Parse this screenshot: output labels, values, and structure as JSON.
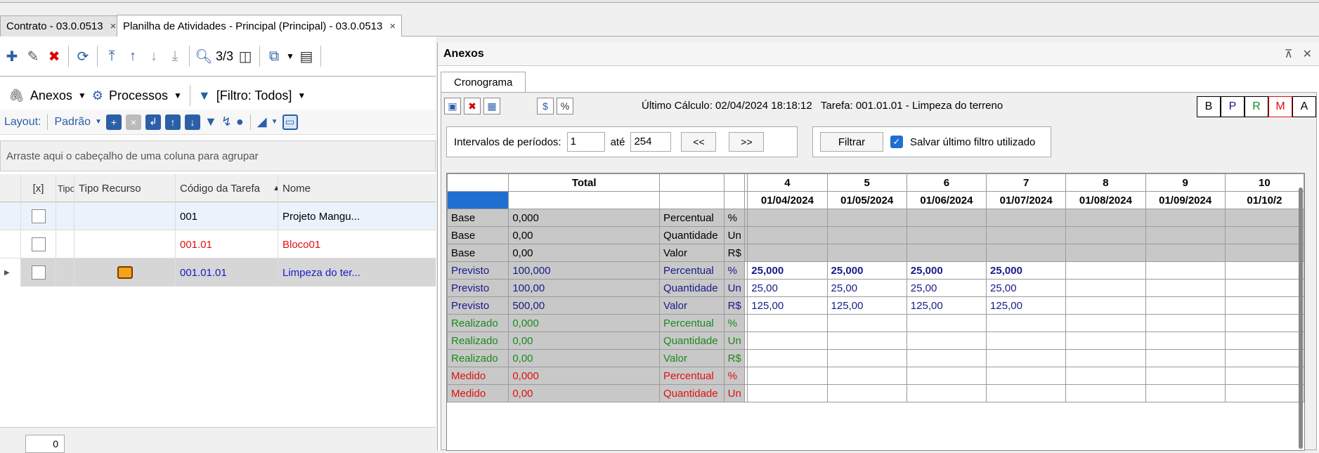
{
  "doc_tabs": [
    {
      "label": "Contrato - 03.0.0513",
      "close": "×"
    },
    {
      "label": "Planilha de Atividades - Principal (Principal) - 03.0.0513",
      "close": "×"
    }
  ],
  "left": {
    "toolbar": {
      "record_counter": "3/3"
    },
    "toolbar2": {
      "anexos": "Anexos",
      "processos": "Processos",
      "filtro": "[Filtro: Todos]"
    },
    "layout": {
      "label": "Layout:",
      "value": "Padrão"
    },
    "group_hint": "Arraste aqui o cabeçalho de uma coluna para agrupar",
    "columns": [
      "[x]",
      "Tipo",
      "Tipo Recurso",
      "Código da Tarefa",
      "Nome"
    ],
    "rows": [
      {
        "codigo": "001",
        "nome": "Projeto Mangu...",
        "color": "#000000"
      },
      {
        "codigo": "001.01",
        "nome": "Bloco01",
        "color": "#e01010"
      },
      {
        "codigo": "001.01.01",
        "nome": "Limpeza do ter...",
        "color": "#1a1aca"
      }
    ],
    "page_value": "0"
  },
  "right": {
    "title": "Anexos",
    "subtab": "Cronograma",
    "ultimo_calculo_label": "Último Cálculo:",
    "ultimo_calculo_value": "02/04/2024 18:18:12",
    "tarefa_label": "Tarefa:",
    "tarefa_value": "001.01.01 - Limpeza do terreno",
    "bprma": [
      "B",
      "P",
      "R",
      "M",
      "A"
    ],
    "intervalos_label": "Intervalos de períodos:",
    "from": "1",
    "ate_label": "até",
    "to": "254",
    "prev": "<<",
    "next": ">>",
    "filtrar": "Filtrar",
    "salvar_label": "Salvar último filtro utilizado",
    "grid": {
      "total_label": "Total",
      "period_numbers": [
        "4",
        "5",
        "6",
        "7",
        "8",
        "9",
        "10"
      ],
      "period_dates": [
        "01/04/2024",
        "01/05/2024",
        "01/06/2024",
        "01/07/2024",
        "01/08/2024",
        "01/09/2024",
        "01/10/2"
      ],
      "rows": [
        {
          "tipo": "Base",
          "total": "0,000",
          "medida": "Percentual",
          "un": "%",
          "vals": [
            "",
            "",
            "",
            "",
            "",
            "",
            ""
          ],
          "cls": "gray",
          "txt": ""
        },
        {
          "tipo": "Base",
          "total": "0,00",
          "medida": "Quantidade",
          "un": "Un",
          "vals": [
            "",
            "",
            "",
            "",
            "",
            "",
            ""
          ],
          "cls": "gray",
          "txt": ""
        },
        {
          "tipo": "Base",
          "total": "0,00",
          "medida": "Valor",
          "un": "R$",
          "vals": [
            "",
            "",
            "",
            "",
            "",
            "",
            ""
          ],
          "cls": "gray",
          "txt": ""
        },
        {
          "tipo": "Previsto",
          "total": "100,000",
          "medida": "Percentual",
          "un": "%",
          "vals": [
            "25,000",
            "25,000",
            "25,000",
            "25,000",
            "",
            "",
            ""
          ],
          "cls": "",
          "txt": "blue",
          "bold": true
        },
        {
          "tipo": "Previsto",
          "total": "100,00",
          "medida": "Quantidade",
          "un": "Un",
          "vals": [
            "25,00",
            "25,00",
            "25,00",
            "25,00",
            "",
            "",
            ""
          ],
          "cls": "",
          "txt": "blue"
        },
        {
          "tipo": "Previsto",
          "total": "500,00",
          "medida": "Valor",
          "un": "R$",
          "vals": [
            "125,00",
            "125,00",
            "125,00",
            "125,00",
            "",
            "",
            ""
          ],
          "cls": "",
          "txt": "blue"
        },
        {
          "tipo": "Realizado",
          "total": "0,000",
          "medida": "Percentual",
          "un": "%",
          "vals": [
            "",
            "",
            "",
            "",
            "",
            "",
            ""
          ],
          "cls": "",
          "txt": "green"
        },
        {
          "tipo": "Realizado",
          "total": "0,00",
          "medida": "Quantidade",
          "un": "Un",
          "vals": [
            "",
            "",
            "",
            "",
            "",
            "",
            ""
          ],
          "cls": "",
          "txt": "green"
        },
        {
          "tipo": "Realizado",
          "total": "0,00",
          "medida": "Valor",
          "un": "R$",
          "vals": [
            "",
            "",
            "",
            "",
            "",
            "",
            ""
          ],
          "cls": "",
          "txt": "green"
        },
        {
          "tipo": "Medido",
          "total": "0,000",
          "medida": "Percentual",
          "un": "%",
          "vals": [
            "",
            "",
            "",
            "",
            "",
            "",
            ""
          ],
          "cls": "",
          "txt": "red"
        },
        {
          "tipo": "Medido",
          "total": "0,00",
          "medida": "Quantidade",
          "un": "Un",
          "vals": [
            "",
            "",
            "",
            "",
            "",
            "",
            ""
          ],
          "cls": "",
          "txt": "red"
        }
      ]
    }
  },
  "colors": {
    "accent": "#2b5fa8",
    "selected": "#1f6fd0",
    "base_gray": "#c8c8c8"
  }
}
